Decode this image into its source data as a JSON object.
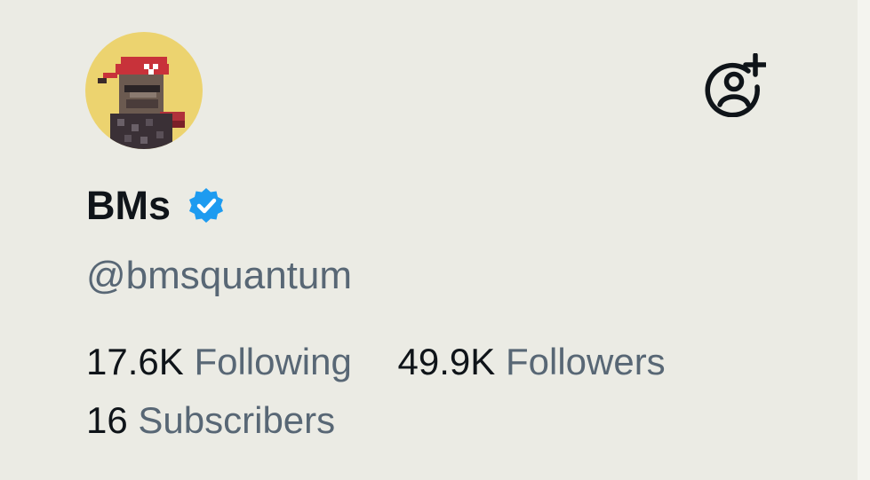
{
  "profile": {
    "display_name": "BMs",
    "handle": "@bmsquantum",
    "verified": true
  },
  "stats": {
    "following_count": "17.6K",
    "following_label": "Following",
    "followers_count": "49.9K",
    "followers_label": "Followers",
    "subscribers_count": "16",
    "subscribers_label": "Subscribers"
  },
  "icons": {
    "follow": "person-add-icon",
    "verified": "verified-badge-icon",
    "avatar": "pixel-art-avatar"
  },
  "colors": {
    "background": "#ebebe4",
    "text_primary": "#0f1419",
    "text_secondary": "#586775",
    "verified_blue": "#1d9bf0",
    "avatar_bg": "#ecd36f"
  }
}
